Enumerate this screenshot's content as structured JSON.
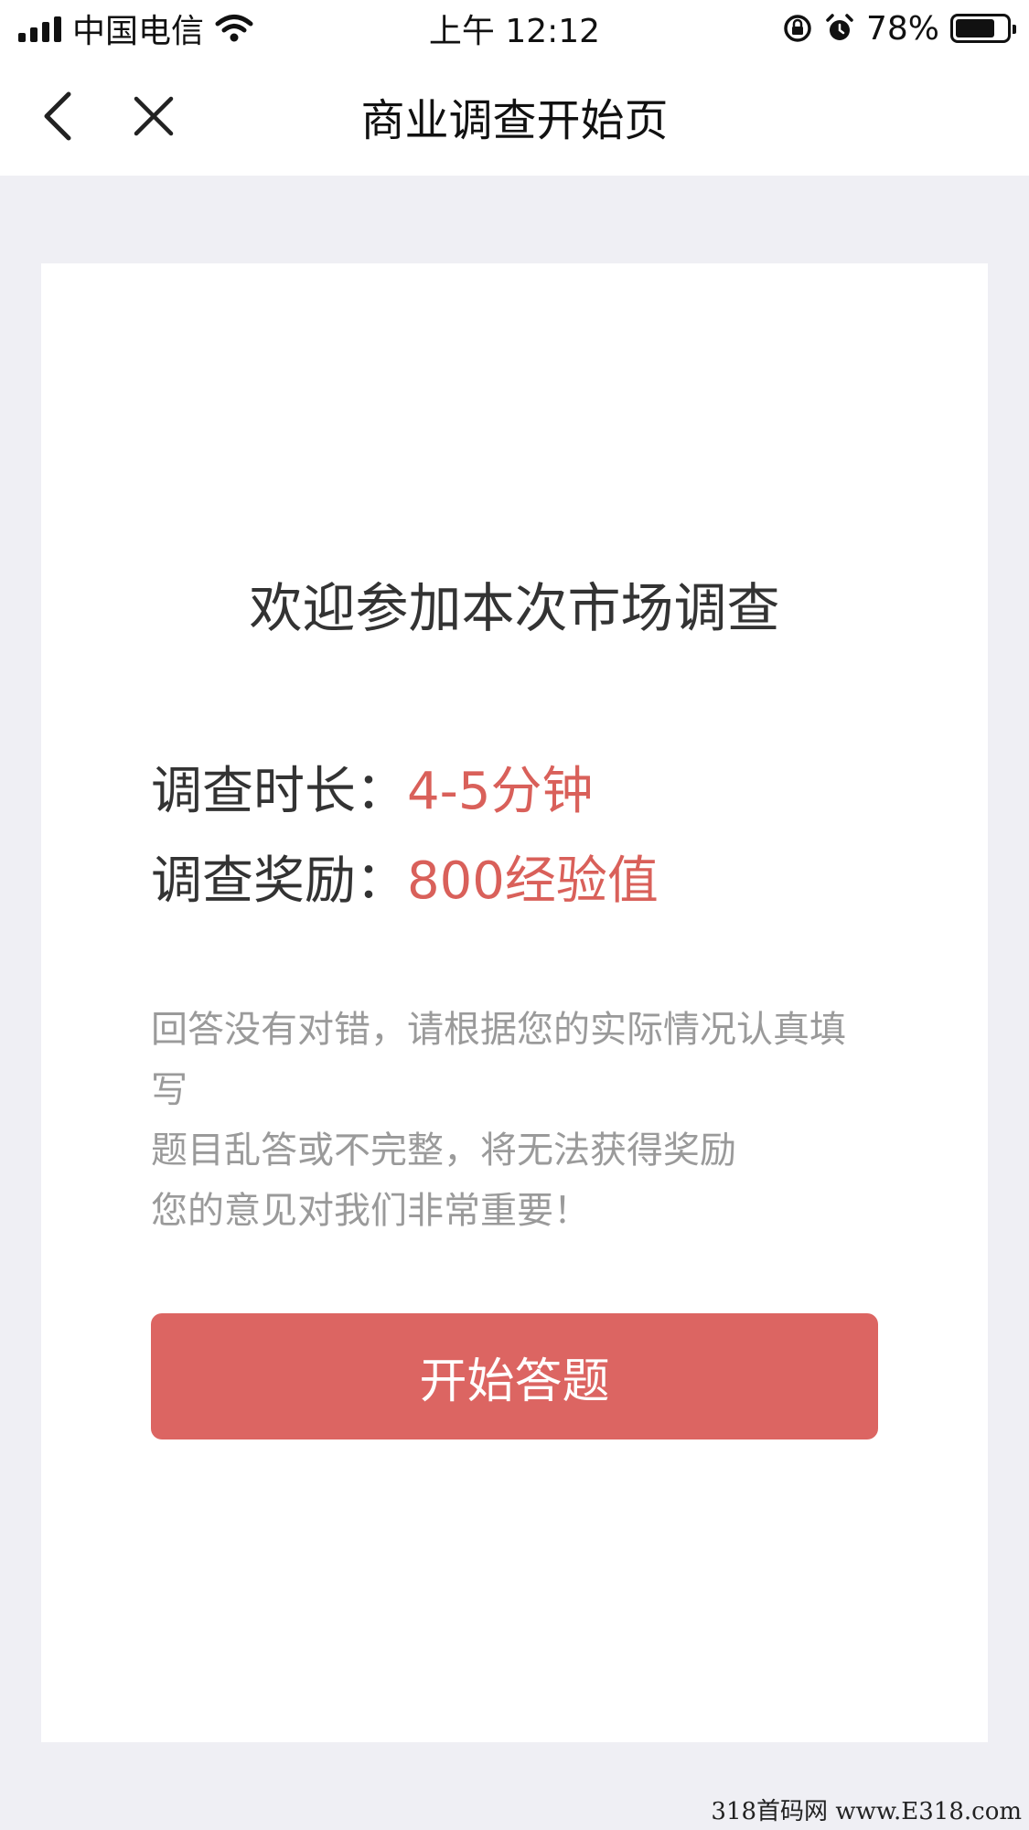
{
  "status_bar": {
    "carrier": "中国电信",
    "time": "上午 12:12",
    "battery_percent": "78%",
    "battery_level": 0.78,
    "icons": [
      "signal-icon",
      "wifi-icon",
      "rotation-lock-icon",
      "alarm-icon",
      "battery-icon"
    ]
  },
  "nav": {
    "title": "商业调查开始页",
    "back_icon": "back-chevron-icon",
    "close_icon": "close-icon"
  },
  "card": {
    "welcome": "欢迎参加本次市场调查",
    "duration_label": "调查时长：",
    "duration_value": "4-5分钟",
    "reward_label": "调查奖励：",
    "reward_value": "800经验值",
    "notes": [
      "回答没有对错，请根据您的实际情况认真填写",
      "题目乱答或不完整，将无法获得奖励",
      "您的意见对我们非常重要！"
    ],
    "start_button": "开始答题"
  },
  "watermark": "318首码网 www.E318.com",
  "colors": {
    "accent": "#dc6562",
    "value_text": "#d9605a",
    "page_background": "#efeff4",
    "note_text": "#9a9a9a"
  }
}
